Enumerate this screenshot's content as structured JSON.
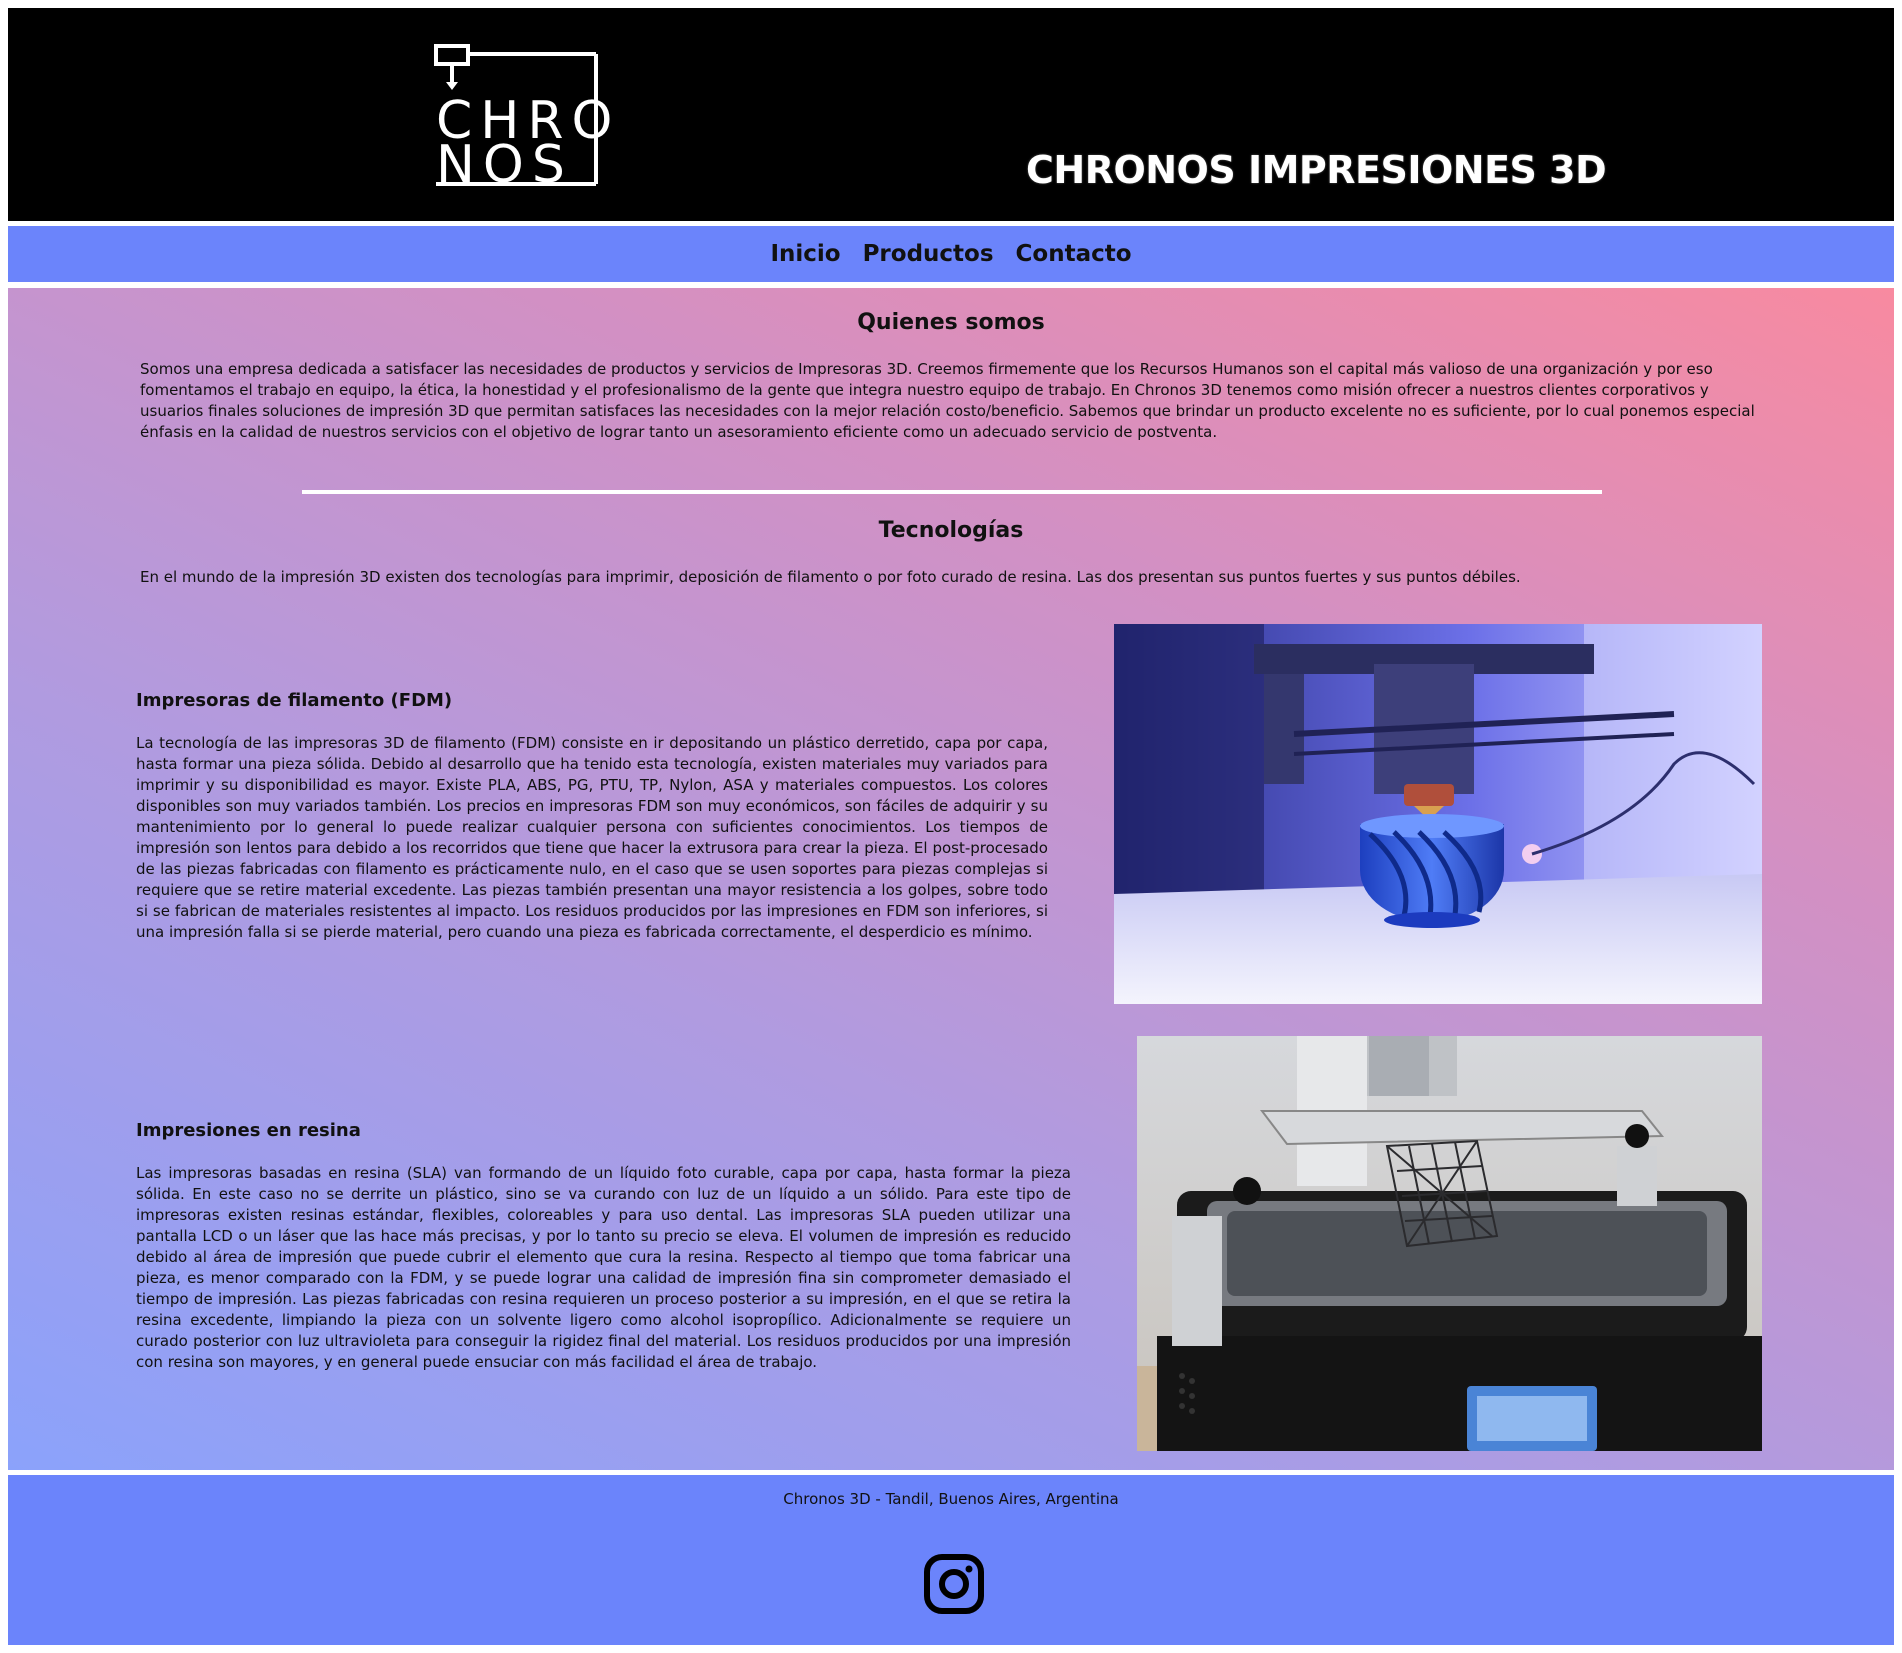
{
  "header": {
    "logo_top": "CHRO",
    "logo_bottom": "NOS",
    "title": "CHRONOS IMPRESIONES 3D"
  },
  "nav": {
    "items": [
      {
        "label": "Inicio"
      },
      {
        "label": "Productos"
      },
      {
        "label": "Contacto"
      }
    ]
  },
  "about": {
    "title": "Quienes somos",
    "text": "Somos una empresa dedicada a satisfacer las necesidades de productos y servicios de Impresoras 3D. Creemos firmemente que los Recursos Humanos son el capital más valioso de una organización y por eso fomentamos el trabajo en equipo, la ética, la honestidad y el profesionalismo de la gente que integra nuestro equipo de trabajo. En Chronos 3D tenemos como misión ofrecer a nuestros clientes corporativos y usuarios finales soluciones de impresión 3D que permitan satisfaces las necesidades con la mejor relación costo/beneficio. Sabemos que brindar un producto excelente no es suficiente, por lo cual ponemos especial énfasis en la calidad de nuestros servicios con el objetivo de lograr tanto un asesoramiento eficiente como un adecuado servicio de postventa."
  },
  "tech": {
    "title": "Tecnologías",
    "intro": "En el mundo de la impresión 3D existen dos tecnologías para imprimir, deposición de filamento o por foto curado de resina. Las dos presentan sus puntos fuertes y sus puntos débiles.",
    "fdm": {
      "title": "Impresoras de filamento (FDM)",
      "text": "La tecnología de las impresoras 3D de filamento (FDM) consiste en ir depositando un plástico derretido, capa por capa, hasta formar una pieza sólida. Debido al desarrollo que ha tenido esta tecnología, existen materiales muy variados para imprimir y su disponibilidad es mayor. Existe PLA, ABS, PG, PTU, TP, Nylon, ASA y materiales compuestos. Los colores disponibles son muy variados también. Los precios en impresoras FDM son muy económicos, son fáciles de adquirir y su mantenimiento por lo general lo puede realizar cualquier persona con suficientes conocimientos. Los tiempos de impresión son lentos para debido a los recorridos que tiene que hacer la extrusora para crear la pieza. El post-procesado de las piezas fabricadas con filamento es prácticamente nulo, en el caso que se usen soportes para piezas complejas si requiere que se retire material excedente. Las piezas también presentan una mayor resistencia a los golpes, sobre todo si se fabrican de materiales resistentes al impacto. Los residuos producidos por las impresiones en FDM son inferiores, si una impresión falla si se pierde material, pero cuando una pieza es fabricada correctamente, el desperdicio es mínimo."
    },
    "resin": {
      "title": "Impresiones en resina",
      "text": "Las impresoras basadas en resina (SLA) van formando de un líquido foto curable, capa por capa, hasta formar la pieza sólida. En este caso no se derrite un plástico, sino se va curando con luz de un líquido a un sólido. Para este tipo de impresoras existen resinas estándar, flexibles, coloreables y para uso dental. Las impresoras SLA pueden utilizar una pantalla LCD o un láser que las hace más precisas, y por lo tanto su precio se eleva. El volumen de impresión es reducido debido al área de impresión que puede cubrir el elemento que cura la resina. Respecto al tiempo que toma fabricar una pieza, es menor comparado con la FDM, y se puede lograr una calidad de impresión fina sin comprometer demasiado el tiempo de impresión. Las piezas fabricadas con resina requieren un proceso posterior a su impresión, en el que se retira la resina excedente, limpiando la pieza con un solvente ligero como alcohol isopropílico. Adicionalmente se requiere un curado posterior con luz ultravioleta para conseguir la rigidez final del material. Los residuos producidos por una impresión con resina son mayores, y en general puede ensuciar con más facilidad el área de trabajo."
    }
  },
  "footer": {
    "text": "Chronos 3D - Tandil, Buenos Aires, Argentina",
    "icon": "instagram-icon"
  },
  "colors": {
    "header_bg": "#000000",
    "nav_bg": "#6b84fb",
    "footer_bg": "#6b84fb",
    "gradient_start": "#8ba2fb",
    "gradient_end": "#f88aa0"
  }
}
